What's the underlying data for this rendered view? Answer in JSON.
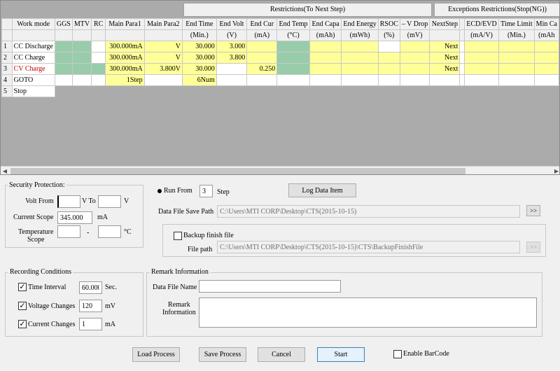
{
  "grid": {
    "group_restrictions": "Restrictions(To Next Step)",
    "group_exceptions": "Exceptions Restrictions(Stop(NG))",
    "headers": [
      "",
      "Work mode",
      "GGS",
      "MTV",
      "RC",
      "Main Para1",
      "Main Para2",
      "End Time",
      "End Volt",
      "End Cur",
      "End Temp",
      "End Capa",
      "End Energy",
      "RSOC",
      "– V Drop",
      "NextStep",
      "",
      "ECD/EVD",
      "Time Limit",
      "Min Ca"
    ],
    "units": [
      "",
      "",
      "",
      "",
      "",
      "",
      "",
      "(Min.)",
      "(V)",
      "(mA)",
      "(°C)",
      "(mAh)",
      "(mWh)",
      "(%)",
      "(mV)",
      "",
      "",
      "(mA/V)",
      "(Min.)",
      "(mAh"
    ],
    "rows": [
      {
        "num": "1",
        "mode": "CC Discharge",
        "p1": "300.000mA",
        "p2": "V",
        "time": "30.000",
        "volt": "3.000",
        "cur": "",
        "next": "Next"
      },
      {
        "num": "2",
        "mode": "CC Charge",
        "p1": "300.000mA",
        "p2": "V",
        "time": "30.000",
        "volt": "3.800",
        "cur": "",
        "next": "Next"
      },
      {
        "num": "3",
        "mode": "CV Charge",
        "p1": "300.000mA",
        "p2": "3.800V",
        "time": "30.000",
        "volt": "",
        "cur": "0.250",
        "next": "Next"
      },
      {
        "num": "4",
        "mode": "GOTO",
        "p1": "1Step",
        "p2": "",
        "time": "6Num",
        "volt": "",
        "cur": "",
        "next": ""
      },
      {
        "num": "5",
        "mode": "Stop",
        "p1": "",
        "p2": "",
        "time": "",
        "volt": "",
        "cur": "",
        "next": ""
      }
    ]
  },
  "security": {
    "title": "Security Protection:",
    "volt_from_label": "Volt From",
    "volt_from_value": "",
    "v_to_label": "V To",
    "volt_to_value": "",
    "v_unit": "V",
    "current_scope_label": "Current Scope",
    "current_scope_value": "345.000",
    "current_unit": "mA",
    "temp_label_1": "Temperature",
    "temp_label_2": "Scope",
    "temp_from": "",
    "dash": "-",
    "temp_to": "",
    "temp_unit": "°C"
  },
  "run": {
    "run_from_label": "Run From",
    "run_from_value": "3",
    "step_label": "Step",
    "log_button": "Log Data Item",
    "save_path_label": "Data File Save Path",
    "save_path_value": "C:\\Users\\MTI CORP\\Desktop\\CTS(2015-10-15)",
    "browse_button": ">>",
    "backup_label": "Backup finish file",
    "file_path_label": "File path",
    "file_path_value": "C:\\Users\\MTI CORP\\Desktop\\CTS(2015-10-15)\\CTS\\BackupFinishFile",
    "backup_browse_button": ">>"
  },
  "recording": {
    "title": "Recording Conditions",
    "time_interval_label": "Time Interval",
    "time_interval_value": "60.000",
    "time_unit": "Sec.",
    "voltage_changes_label": "Voltage Changes",
    "voltage_changes_value": "120",
    "voltage_unit": "mV",
    "current_changes_label": "Current Changes",
    "current_changes_value": "1",
    "current_unit": "mA"
  },
  "remark": {
    "title": "Remark Information",
    "data_file_name_label": "Data File Name",
    "data_file_name_value": "",
    "remark_label_1": "Remark",
    "remark_label_2": "Information",
    "remark_value": ""
  },
  "footer": {
    "load_button": "Load Process",
    "save_button": "Save Process",
    "cancel_button": "Cancel",
    "start_button": "Start",
    "barcode_label": "Enable BarCode"
  },
  "colors": {
    "yellow_cell": "#ffff99",
    "green_cell": "#99ccaa",
    "cv_charge_text": "#c00000"
  }
}
